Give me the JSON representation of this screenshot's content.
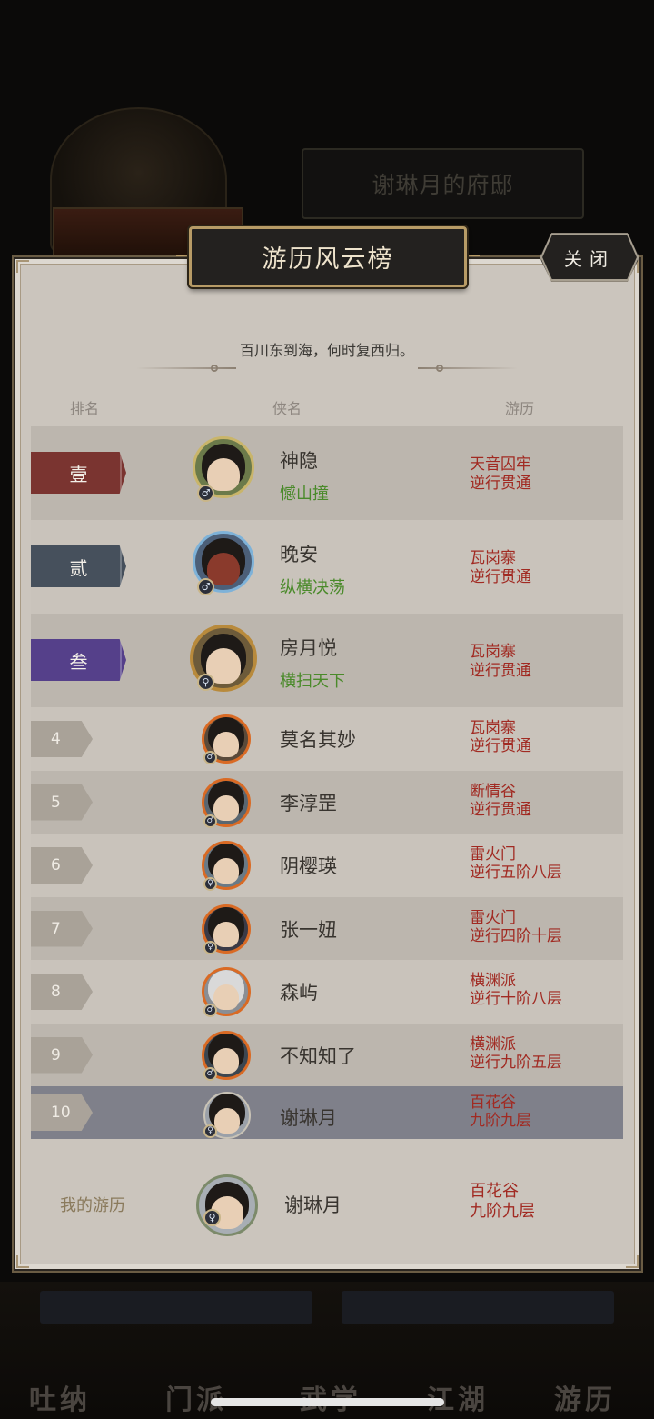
{
  "background": {
    "mansion_label": "谢琳月的府邸",
    "nav_items": [
      "吐纳",
      "门派",
      "武学",
      "江湖",
      "游历"
    ]
  },
  "dialog": {
    "title": "游历风云榜",
    "close_label": "关闭",
    "slogan": "百川东到海，何时复西归。",
    "columns": {
      "rank": "排名",
      "name": "侠名",
      "progress": "游历"
    }
  },
  "ranking": [
    {
      "rank": "壹",
      "name": "神隐",
      "title": "憾山撞",
      "location": "天音囚牢",
      "level": "逆行贯通",
      "gender": "male",
      "plate_color": "#7a3430"
    },
    {
      "rank": "贰",
      "name": "晚安",
      "title": "纵横决荡",
      "location": "瓦岗寨",
      "level": "逆行贯通",
      "gender": "male",
      "plate_color": "#46505c"
    },
    {
      "rank": "叁",
      "name": "房月悦",
      "title": "横扫天下",
      "location": "瓦岗寨",
      "level": "逆行贯通",
      "gender": "female",
      "plate_color": "#55408a"
    },
    {
      "rank": "4",
      "name": "莫名其妙",
      "location": "瓦岗寨",
      "level": "逆行贯通",
      "gender": "male"
    },
    {
      "rank": "5",
      "name": "李淳罡",
      "location": "断情谷",
      "level": "逆行贯通",
      "gender": "male"
    },
    {
      "rank": "6",
      "name": "阴樱瑛",
      "location": "雷火门",
      "level": "逆行五阶八层",
      "gender": "female"
    },
    {
      "rank": "7",
      "name": "张一妞",
      "location": "雷火门",
      "level": "逆行四阶十层",
      "gender": "female"
    },
    {
      "rank": "8",
      "name": "森屿",
      "location": "横渊派",
      "level": "逆行十阶八层",
      "gender": "male"
    },
    {
      "rank": "9",
      "name": "不知知了",
      "location": "横渊派",
      "level": "逆行九阶五层",
      "gender": "male"
    },
    {
      "rank": "10",
      "name": "谢琳月",
      "location": "百花谷",
      "level": "九阶九层",
      "gender": "female"
    }
  ],
  "my_record": {
    "label": "我的游历",
    "name": "谢琳月",
    "location": "百花谷",
    "level": "九阶九层"
  },
  "colors": {
    "title_green": "#4a8a2a",
    "progress_red": "#a12a22",
    "frame_gold": "#b79b66",
    "panel_bg": "#cbc5bd"
  }
}
